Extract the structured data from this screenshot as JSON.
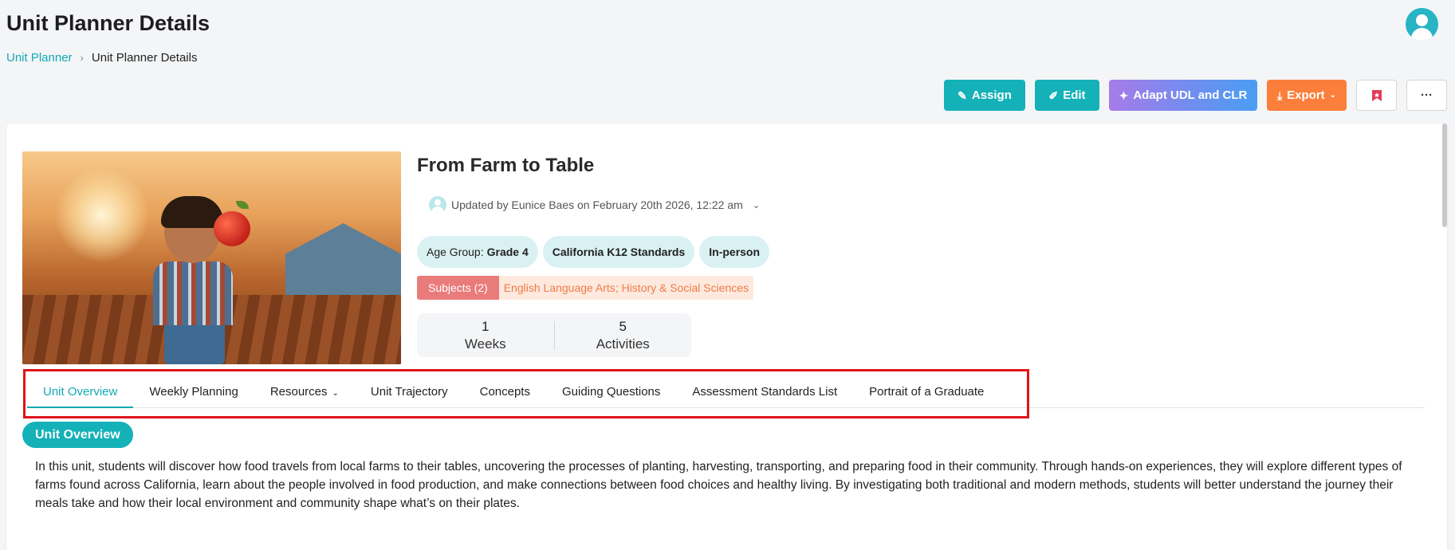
{
  "header": {
    "title": "Unit Planner Details"
  },
  "breadcrumb": {
    "parent": "Unit Planner",
    "current": "Unit Planner Details"
  },
  "toolbar": {
    "assign_label": "Assign",
    "edit_label": "Edit",
    "adapt_label": "Adapt UDL and CLR",
    "export_label": "Export",
    "more_label": "···"
  },
  "unit": {
    "title": "From Farm to Table",
    "updated_text": "Updated by Eunice Baes on February 20th 2026, 12:22 am",
    "age_group_label": "Age Group:",
    "age_group_value": "Grade 4",
    "standards": "California K12 Standards",
    "mode": "In-person",
    "subjects_label": "Subjects (2)",
    "subjects_list": "English Language Arts; History & Social Sciences",
    "stats": [
      {
        "value": "1",
        "label": "Weeks"
      },
      {
        "value": "5",
        "label": "Activities"
      }
    ]
  },
  "tabs": [
    {
      "label": "Unit Overview",
      "active": true
    },
    {
      "label": "Weekly Planning"
    },
    {
      "label": "Resources",
      "dropdown": true
    },
    {
      "label": "Unit Trajectory"
    },
    {
      "label": "Concepts"
    },
    {
      "label": "Guiding Questions"
    },
    {
      "label": "Assessment Standards List"
    },
    {
      "label": "Portrait of a Graduate"
    }
  ],
  "overview": {
    "heading": "Unit Overview",
    "text": "In this unit, students will discover how food travels from local farms to their tables, uncovering the processes of planting, harvesting, transporting, and preparing food in their community. Through hands-on experiences, they will explore different types of farms found across California, learn about the people involved in food production, and make connections between food choices and healthy living. By investigating both traditional and modern methods, students will better understand the journey their meals take and how their local environment and community shape what’s on their plates."
  },
  "colors": {
    "accent": "#14b1b8",
    "export": "#fb7f3a",
    "highlight": "#e0141b"
  }
}
